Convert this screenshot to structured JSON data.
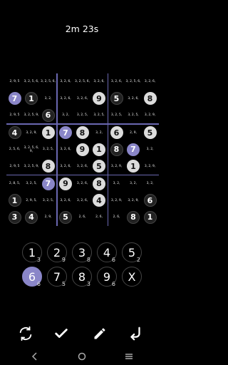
{
  "timer": "2m 23s",
  "board": [
    [
      {
        "n": "2, 9, 5"
      },
      {
        "n": "3, 2, 5, 6,"
      },
      {
        "n": "3, 2, 5, 6,"
      },
      {
        "n": "3, 2, 6,"
      },
      {
        "n": "3, 2, 5, 6,"
      },
      {
        "n": "3, 2, 6,"
      },
      {
        "n": "3, 2, 6,"
      },
      {
        "n": "3, 2, 5, 6,"
      },
      {
        "n": "3, 2, 6,"
      }
    ],
    [
      {
        "v": "7",
        "t": "sel"
      },
      {
        "v": "1",
        "t": "filled"
      },
      {
        "n": "3, 2,"
      },
      {
        "n": "3, 2, 6,"
      },
      {
        "n": "3, 2, 6,"
      },
      {
        "v": "9",
        "t": "given"
      },
      {
        "v": "5",
        "t": "filled"
      },
      {
        "n": "3, 2, 6,"
      },
      {
        "v": "8",
        "t": "given"
      }
    ],
    [
      {
        "n": "2, 9, 5"
      },
      {
        "n": "3, 2, 5, 9,"
      },
      {
        "v": "6",
        "t": "filled"
      },
      {
        "n": "3, 2,"
      },
      {
        "n": "3, 2, 5,"
      },
      {
        "n": "3, 2, 5,"
      },
      {
        "n": "3, 2, 5,"
      },
      {
        "n": "3, 2, 5,"
      },
      {
        "n": "3, 2, 9,"
      }
    ],
    [
      {
        "v": "4",
        "t": "filled"
      },
      {
        "n": "3, 2, 9,"
      },
      {
        "v": "1",
        "t": "given"
      },
      {
        "v": "7",
        "t": "sel"
      },
      {
        "v": "8",
        "t": "given"
      },
      {
        "n": "3, 2,"
      },
      {
        "v": "6",
        "t": "given"
      },
      {
        "n": "2, 9,"
      },
      {
        "v": "5",
        "t": "given"
      }
    ],
    [
      {
        "n": "2, 5, 6,"
      },
      {
        "n": "3, 2, 5, 6, 9,"
      },
      {
        "n": "3, 2, 5,"
      },
      {
        "n": "3, 2, 6,"
      },
      {
        "v": "9",
        "t": "given"
      },
      {
        "v": "1",
        "t": "given"
      },
      {
        "v": "8",
        "t": "filled"
      },
      {
        "v": "7",
        "t": "sel"
      },
      {
        "n": "3, 2,"
      }
    ],
    [
      {
        "n": "2, 9, 5"
      },
      {
        "n": "3, 2, 5, 9,"
      },
      {
        "v": "8",
        "t": "given"
      },
      {
        "n": "3, 2, 6,"
      },
      {
        "n": "3, 2, 6,"
      },
      {
        "v": "5",
        "t": "given"
      },
      {
        "n": "3, 2, 9,"
      },
      {
        "v": "1",
        "t": "given"
      },
      {
        "n": "3, 2, 9,"
      }
    ],
    [
      {
        "n": "2, 8, 5,"
      },
      {
        "n": "3, 2, 5,"
      },
      {
        "v": "7",
        "t": "sel"
      },
      {
        "v": "9",
        "t": "given"
      },
      {
        "n": "3, 2, 6,"
      },
      {
        "v": "8",
        "t": "given"
      },
      {
        "n": "3, 2,"
      },
      {
        "n": "3, 2,"
      },
      {
        "n": "3, 2,"
      }
    ],
    [
      {
        "v": "1",
        "t": "filled"
      },
      {
        "n": "2, 9, 5,"
      },
      {
        "n": "3, 2, 5,"
      },
      {
        "n": "3, 2, 6,"
      },
      {
        "n": "3, 2, 6,"
      },
      {
        "v": "4",
        "t": "given"
      },
      {
        "n": "3, 2, 9,"
      },
      {
        "n": "3, 2, 9,"
      },
      {
        "v": "6",
        "t": "filled"
      }
    ],
    [
      {
        "v": "3",
        "t": "filled"
      },
      {
        "v": "4",
        "t": "filled"
      },
      {
        "n": "2, 9,"
      },
      {
        "v": "5",
        "t": "filled"
      },
      {
        "n": "2, 6,"
      },
      {
        "n": "2, 6,"
      },
      {
        "n": "2, 6,"
      },
      {
        "v": "8",
        "t": "filled"
      },
      {
        "v": "1",
        "t": "filled"
      }
    ]
  ],
  "keys": [
    {
      "label": "1",
      "count": "3",
      "active": false
    },
    {
      "label": "2",
      "count": "9",
      "active": false
    },
    {
      "label": "3",
      "count": "8",
      "active": false
    },
    {
      "label": "4",
      "count": "6",
      "active": false
    },
    {
      "label": "5",
      "count": "2",
      "active": false
    },
    {
      "label": "6",
      "count": "6",
      "active": true
    },
    {
      "label": "7",
      "count": "5",
      "active": false
    },
    {
      "label": "8",
      "count": "3",
      "active": false
    },
    {
      "label": "9",
      "count": "6",
      "active": false
    },
    {
      "label": "X",
      "count": "",
      "active": false
    }
  ],
  "toolbar": {
    "icons": [
      "rotate-icon",
      "check-icon",
      "pencil-icon",
      "undo-icon"
    ]
  },
  "colors": {
    "accent": "#8a86c8",
    "grid": "#6a67b0"
  }
}
